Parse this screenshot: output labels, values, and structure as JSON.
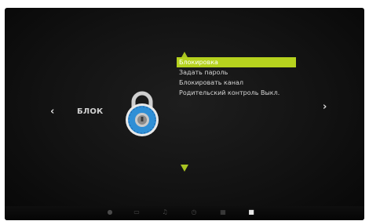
{
  "screen": {
    "section_title": "БЛОК",
    "left_arrow": "‹",
    "right_arrow": "›"
  },
  "menu": {
    "items": [
      {
        "label": "Блокировка",
        "selected": true
      },
      {
        "label": "Задать пароль",
        "selected": false
      },
      {
        "label": "Блокировать канал",
        "selected": false
      },
      {
        "label": "Родительский контроль Выкл.",
        "selected": false
      }
    ]
  },
  "bottom_bar": {
    "icons": [
      {
        "name": "picture-icon",
        "glyph": "●",
        "active": false
      },
      {
        "name": "display-icon",
        "glyph": "▭",
        "active": false
      },
      {
        "name": "music-icon",
        "glyph": "♫",
        "active": false
      },
      {
        "name": "clock-icon",
        "glyph": "◷",
        "active": false
      },
      {
        "name": "apps-icon",
        "glyph": "▦",
        "active": false
      },
      {
        "name": "lock-icon",
        "glyph": "■",
        "active": true
      }
    ]
  },
  "colors": {
    "accent": "#b6d21e",
    "lock_blue": "#2f8fd6"
  }
}
